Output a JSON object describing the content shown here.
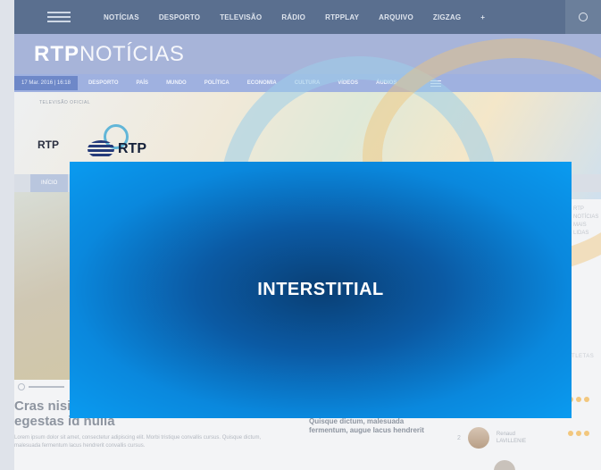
{
  "topnav": {
    "items": [
      "NOTÍCIAS",
      "DESPORTO",
      "TELEVISÃO",
      "RÁDIO",
      "RTPPLAY",
      "ARQUIVO",
      "ZIGZAG",
      "+"
    ]
  },
  "brand": {
    "bold": "RTP",
    "light": "NOTÍCIAS"
  },
  "secnav": {
    "date": "17 Mar. 2016 | 16:18",
    "items": [
      "DESPORTO",
      "PAÍS",
      "MUNDO",
      "POLÍTICA",
      "ECONOMIA",
      "CULTURA",
      "VÍDEOS",
      "ÁUDIOS"
    ]
  },
  "hero": {
    "sponsor_label": "TELEVISÃO OFICIAL",
    "rtp_small": "RTP",
    "rtp_big": "RTP"
  },
  "tabs": {
    "active": "INÍCIO"
  },
  "article": {
    "headline_line1": "Cras nisi",
    "headline_line2": "egestas id nulla",
    "lorem": "Lorem ipsum dolor sit amet, consectetur adipiscing elit. Morbi tristique convallis cursus. Quisque dictum, malesuada fermentum lacus hendrerit convallis cursus.",
    "mid_text": "Quisque dictum, malesuada fermentum, augue lacus hendrerit"
  },
  "right_col": {
    "lines": [
      "RTP NOTÍCIAS",
      "MAIS LIDAS"
    ],
    "side_label": "ATLETAS",
    "rank_number": "2",
    "rank_name": "Renaud LAVILLENIE"
  },
  "overlay": {
    "label": "INTERSTITIAL"
  },
  "colors": {
    "overlay_edge": "#0a9bf0",
    "overlay_center": "#0a3f74",
    "topnav": "#5a6f8f"
  }
}
